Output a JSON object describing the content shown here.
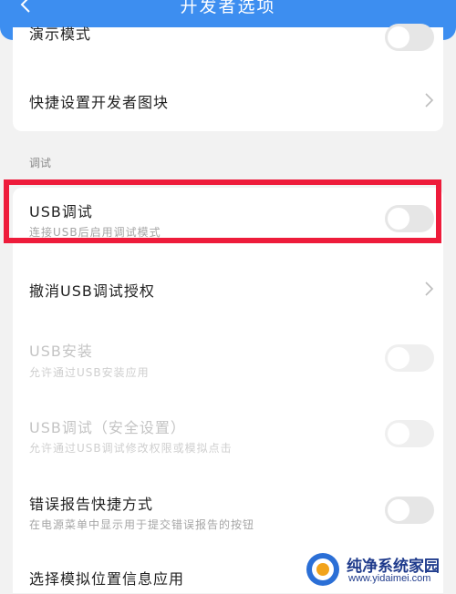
{
  "header": {
    "title": "开发者选项"
  },
  "top_group": {
    "demo_mode_label": "演示模式",
    "quick_tiles_label": "快捷设置开发者图块"
  },
  "debug_section": {
    "title": "调试",
    "usb_debugging": {
      "label": "USB调试",
      "sub": "连接USB后启用调试模式",
      "enabled": false
    },
    "revoke_auth": {
      "label": "撤消USB调试授权"
    },
    "usb_install": {
      "label": "USB安装",
      "sub": "允许通过USB安装应用",
      "enabled": false
    },
    "usb_debug_secure": {
      "label": "USB调试（安全设置）",
      "sub": "允许通过USB调试修改权限或模拟点击",
      "enabled": false
    },
    "bug_report": {
      "label": "错误报告快捷方式",
      "sub": "在电源菜单中显示用于提交错误报告的按钮",
      "enabled": false
    },
    "mock_location": {
      "label": "选择模拟位置信息应用"
    }
  },
  "watermark": {
    "brand": "纯净系统家园",
    "url": "www.yidaimei.com"
  },
  "colors": {
    "header": "#3d8ef0",
    "highlight": "#ee1c3b",
    "toggle_off": "#e6e6e6"
  }
}
